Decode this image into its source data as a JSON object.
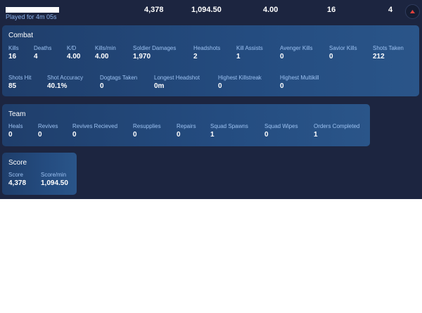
{
  "header": {
    "played_for": "Played for 4m 05s",
    "stats": [
      "4,378",
      "1,094.50",
      "4.00",
      "16",
      "4"
    ]
  },
  "combat": {
    "title": "Combat",
    "stats": [
      {
        "label": "Kills",
        "value": "16"
      },
      {
        "label": "Deaths",
        "value": "4"
      },
      {
        "label": "K/D",
        "value": "4.00"
      },
      {
        "label": "Kills/min",
        "value": "4.00"
      },
      {
        "label": "Soldier Damages",
        "value": "1,970"
      },
      {
        "label": "Headshots",
        "value": "2"
      },
      {
        "label": "Kill Assists",
        "value": "1"
      },
      {
        "label": "Avenger Kills",
        "value": "0"
      },
      {
        "label": "Savior Kills",
        "value": "0"
      },
      {
        "label": "Shots Taken",
        "value": "212"
      },
      {
        "label": "Shots Hit",
        "value": "85"
      },
      {
        "label": "Shot Accuracy",
        "value": "40.1%"
      },
      {
        "label": "Dogtags Taken",
        "value": "0"
      },
      {
        "label": "Longest Headshot",
        "value": "0m"
      },
      {
        "label": "Highest Killstreak",
        "value": "0"
      },
      {
        "label": "Highest Multikill",
        "value": "0"
      }
    ]
  },
  "team": {
    "title": "Team",
    "stats": [
      {
        "label": "Heals",
        "value": "0"
      },
      {
        "label": "Revives",
        "value": "0"
      },
      {
        "label": "Revives Recieved",
        "value": "0"
      },
      {
        "label": "Resupplies",
        "value": "0"
      },
      {
        "label": "Repairs",
        "value": "0"
      },
      {
        "label": "Squad Spawns",
        "value": "1"
      },
      {
        "label": "Squad Wipes",
        "value": "0"
      },
      {
        "label": "Orders Completed",
        "value": "1"
      }
    ]
  },
  "score": {
    "title": "Score",
    "stats": [
      {
        "label": "Score",
        "value": "4,378"
      },
      {
        "label": "Score/min",
        "value": "1,094.50"
      }
    ]
  },
  "icons": {
    "collapse": "chevron-up-icon"
  },
  "colors": {
    "background": "#1c2540",
    "card": "#244c80",
    "label": "#9cc2f2",
    "accent": "#e0413c"
  }
}
